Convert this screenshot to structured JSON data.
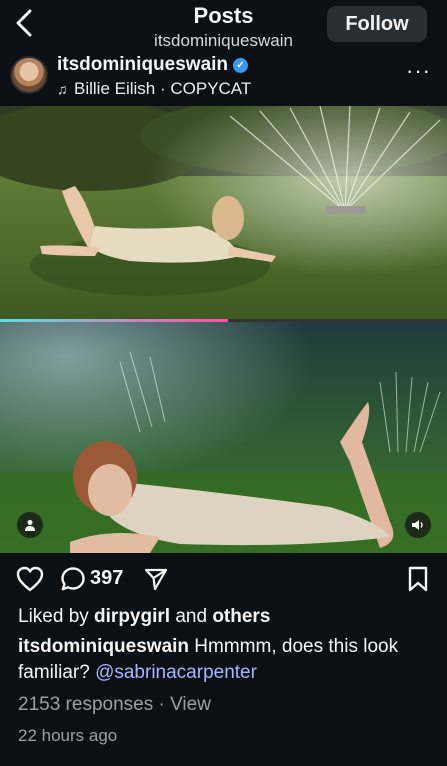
{
  "header": {
    "title": "Posts",
    "subtitle": "itsdominiqueswain",
    "follow_label": "Follow"
  },
  "post": {
    "username": "itsdominiqueswain",
    "verified": true,
    "audio": "Billie Eilish · COPYCAT",
    "media_progress": 0.51
  },
  "actions": {
    "comment_count": "397"
  },
  "likes": {
    "prefix": "Liked by ",
    "user": "dirpygirl",
    "middle": " and ",
    "others": "others"
  },
  "caption": {
    "user": "itsdominiqueswain",
    "text": " Hmmmm, does this look familiar? ",
    "mention": "@sabrinacarpenter"
  },
  "responses": "2153 responses · View",
  "timestamp": "22 hours ago",
  "icons": {
    "back": "chevron-left-icon",
    "verified": "verified-badge-icon",
    "music": "music-note-icon",
    "more": "more-dots-icon",
    "like": "heart-icon",
    "comment": "comment-bubble-icon",
    "share": "paper-plane-icon",
    "save": "bookmark-icon",
    "tagged": "person-icon",
    "sound": "speaker-icon"
  },
  "colors": {
    "background": "#0b1014",
    "mention": "#a8b4ff",
    "verified": "#3897f0",
    "muted_text": "#9aa0a6"
  }
}
